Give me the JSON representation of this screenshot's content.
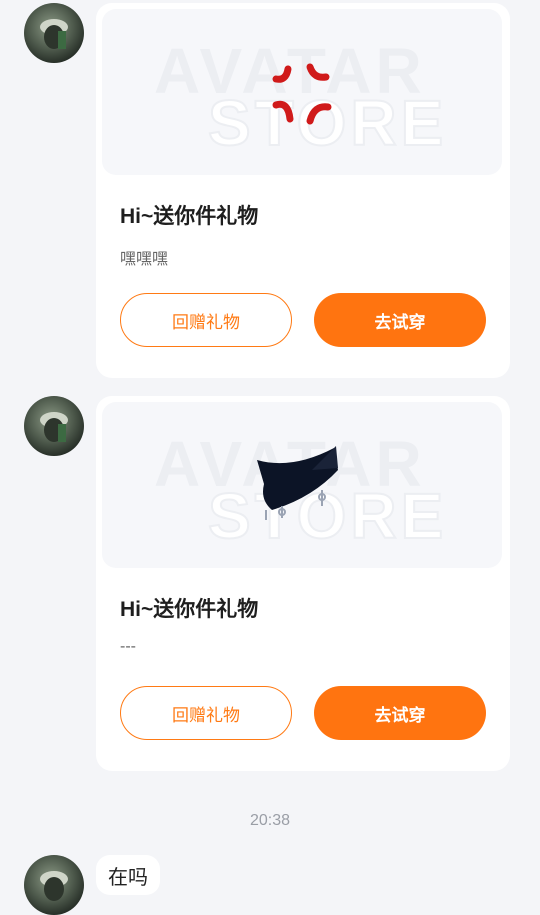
{
  "messages": [
    {
      "gift_title": "Hi~送你件礼物",
      "gift_message": "嘿嘿嘿",
      "item_icon": "anger-symbol-icon",
      "return_gift_label": "回赠礼物",
      "try_on_label": "去试穿",
      "watermark_line1": "AVATAR",
      "watermark_line2": "STORE"
    },
    {
      "gift_title": "Hi~送你件礼物",
      "gift_message": "---",
      "item_icon": "black-choker-icon",
      "return_gift_label": "回赠礼物",
      "try_on_label": "去试穿",
      "watermark_line1": "AVATAR",
      "watermark_line2": "STORE"
    }
  ],
  "timestamp": "20:38",
  "last_message": "在吗",
  "colors": {
    "accent": "#ff7410",
    "background": "#f4f5f8"
  }
}
